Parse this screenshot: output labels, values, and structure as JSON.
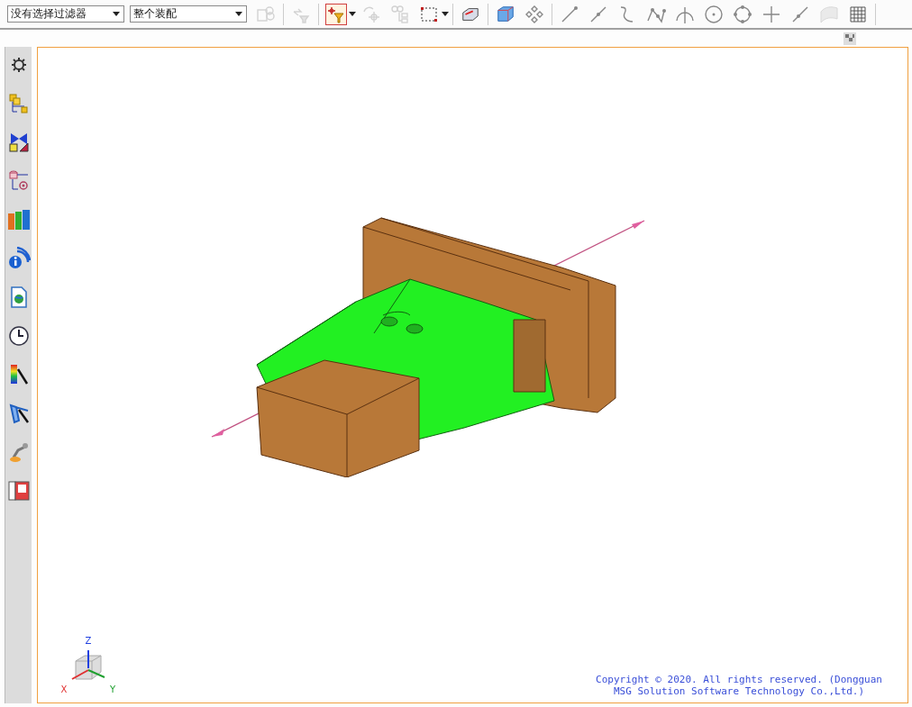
{
  "toolbar": {
    "filters": [
      {
        "value": "没有选择过滤器"
      },
      {
        "value": "整个装配"
      }
    ],
    "buttons": [
      {
        "disabled": true,
        "on": false
      },
      {
        "disabled": true,
        "on": false
      },
      {
        "disabled": false,
        "on": true
      },
      {
        "disabled": true,
        "on": false
      },
      {
        "disabled": true,
        "on": false
      },
      {
        "disabled": false,
        "on": false
      },
      {
        "disabled": false,
        "on": false
      },
      {
        "disabled": false,
        "on": false
      },
      {
        "disabled": false,
        "on": false
      },
      {
        "disabled": false,
        "on": false
      },
      {
        "disabled": false,
        "on": false
      },
      {
        "disabled": false,
        "on": false
      },
      {
        "disabled": false,
        "on": false
      },
      {
        "disabled": false,
        "on": false
      },
      {
        "disabled": false,
        "on": false
      },
      {
        "disabled": false,
        "on": false
      },
      {
        "disabled": false,
        "on": false
      },
      {
        "disabled": false,
        "on": false
      },
      {
        "disabled": true,
        "on": false
      },
      {
        "disabled": false,
        "on": false
      }
    ]
  },
  "viewport": {
    "triad": {
      "x": "X",
      "y": "Y",
      "z": "Z"
    },
    "copyright": [
      "Copyright © 2020. All rights reserved. (Dongguan",
      "MSG Solution Software Technology Co.,Ltd.)"
    ]
  }
}
